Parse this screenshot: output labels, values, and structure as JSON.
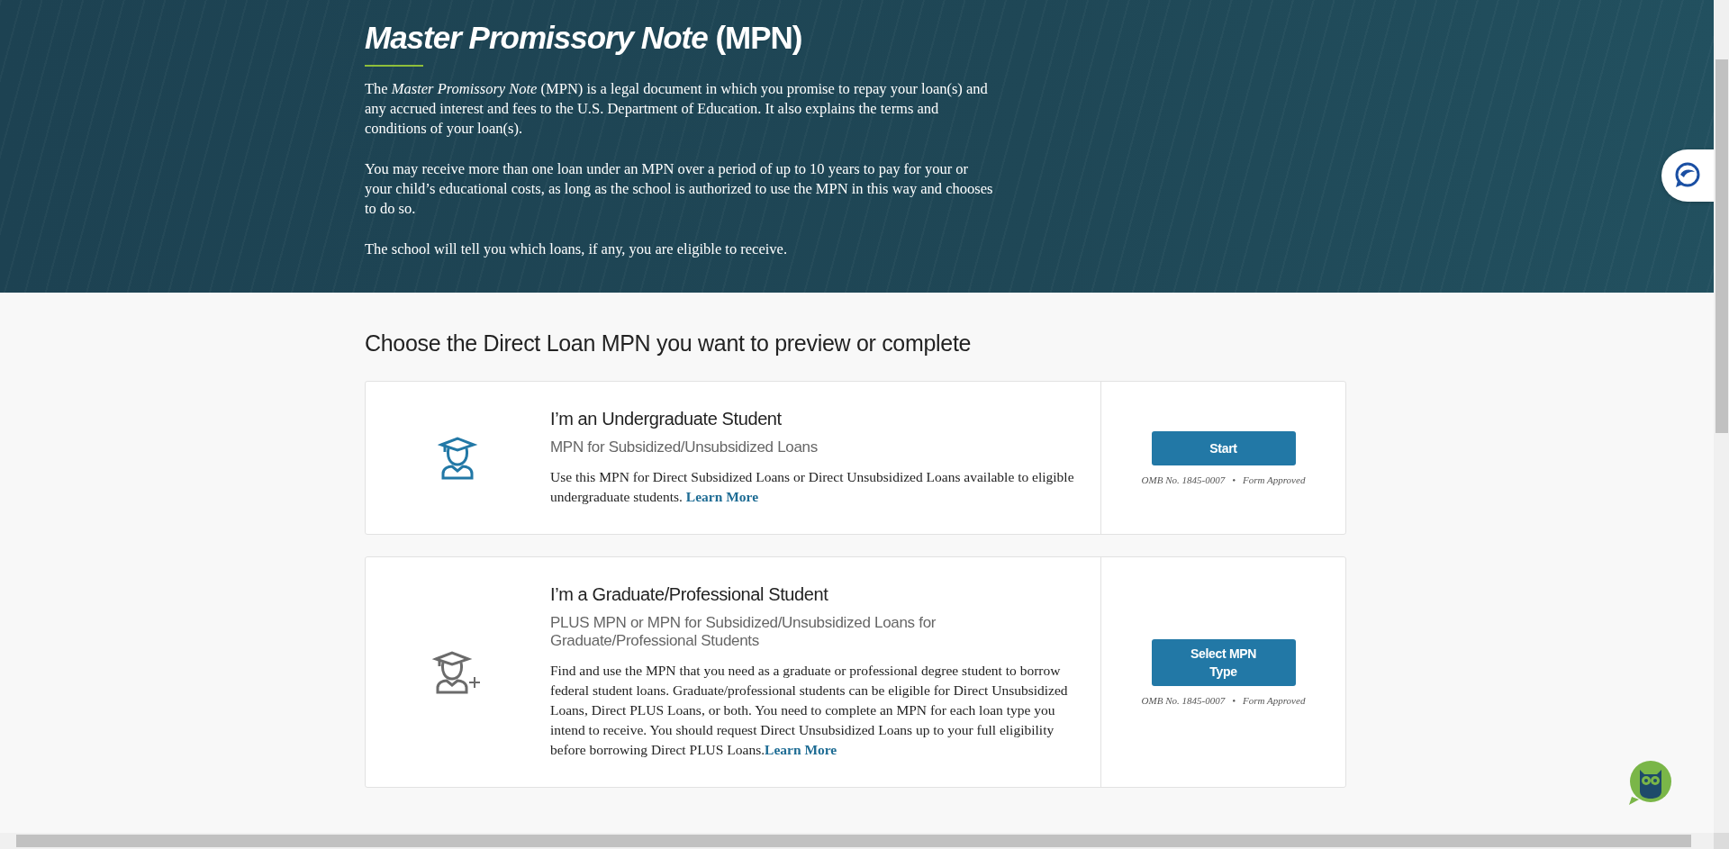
{
  "hero": {
    "title_italic": "Master Promissory Note",
    "title_rest": "(MPN)",
    "paragraphs": [
      "The *Master Promissory Note* (MPN) is a legal document in which you promise to repay your loan(s) and any accrued interest and fees to the U.S. Department of Education. It also explains the terms and conditions of your loan(s).",
      "You may receive more than one loan under an MPN over a period of up to 10 years to pay for your or your child’s educational costs, as long as the school is authorized to use the MPN in this way and chooses to do so.",
      "The school will tell you which loans, if any, you are eligible to receive."
    ]
  },
  "section_heading": "Choose the Direct Loan MPN you want to preview or complete",
  "cards": [
    {
      "kind": "student",
      "title": "I’m an Undergraduate Student",
      "subtitle": "MPN for Subsidized/Unsubsidized Loans",
      "description": "Use this MPN for Direct Subsidized Loans or Direct Unsubsidized Loans available to eligible undergraduate students. ",
      "link": "Learn More",
      "button": "Start",
      "omb": "OMB No. 1845-0007",
      "separator": "•",
      "approval": "Form Approved"
    },
    {
      "kind": "student-plus",
      "title": "I’m a Graduate/Professional Student",
      "subtitle": "PLUS MPN or MPN for Subsidized/Unsubsidized Loans for Graduate/Professional Students",
      "description": "Find and use the MPN that you need as a graduate or professional degree student to borrow federal student loans. Graduate/professional students can be eligible for Direct Unsubsidized Loans, Direct PLUS Loans, or both. You need to complete an MPN for each loan type you intend to receive. You should request Direct Unsubsidized Loans up to your full eligibility before borrowing Direct PLUS Loans.",
      "link": "Learn More",
      "button": "Select MPN Type",
      "omb": "OMB No. 1845-0007",
      "separator": "•",
      "approval": "Form Approved"
    }
  ]
}
